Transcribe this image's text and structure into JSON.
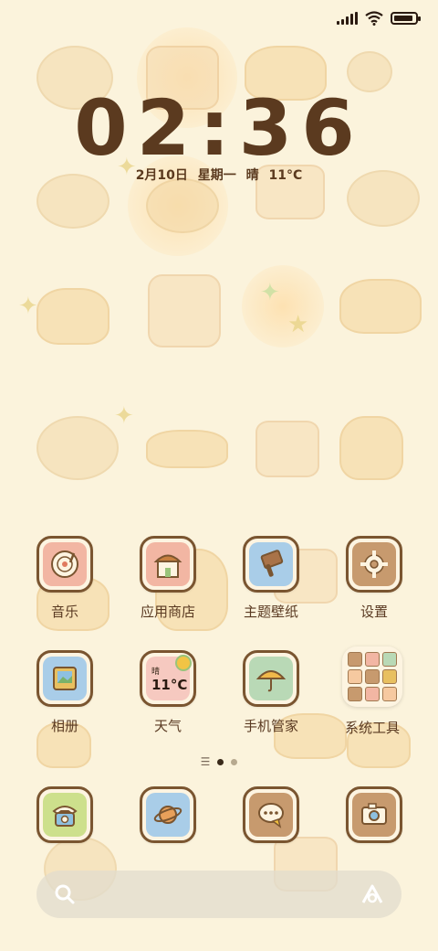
{
  "status_bar": {
    "signal_icon": "signal-icon",
    "wifi_icon": "wifi-icon",
    "battery_icon": "battery-icon",
    "battery_level": 0.9
  },
  "clock": {
    "time": "02:36",
    "date": "2月10日",
    "weekday": "星期一",
    "weather": "晴",
    "temperature": "11°C"
  },
  "apps_row1": [
    {
      "label": "音乐",
      "icon": "music-disc-icon"
    },
    {
      "label": "应用商店",
      "icon": "store-icon"
    },
    {
      "label": "主题壁纸",
      "icon": "paintbrush-icon"
    },
    {
      "label": "设置",
      "icon": "gear-icon"
    }
  ],
  "apps_row2": [
    {
      "label": "相册",
      "icon": "photo-icon"
    },
    {
      "label": "天气",
      "icon": "weather-icon",
      "widget_condition": "晴",
      "widget_temp": "11°C"
    },
    {
      "label": "手机管家",
      "icon": "umbrella-icon"
    },
    {
      "label": "系统工具",
      "icon": "folder-icon"
    }
  ],
  "page_indicator": {
    "pages": 2,
    "active": 1
  },
  "dock": [
    {
      "icon": "phone-icon"
    },
    {
      "icon": "browser-planet-icon"
    },
    {
      "icon": "message-icon"
    },
    {
      "icon": "camera-icon"
    }
  ],
  "search": {
    "search_icon": "search-icon",
    "assistant_icon": "assistant-icon"
  },
  "colors": {
    "background": "#fbf3dc",
    "clock_text": "#5b3a1f",
    "icon_border": "#7a5530"
  }
}
